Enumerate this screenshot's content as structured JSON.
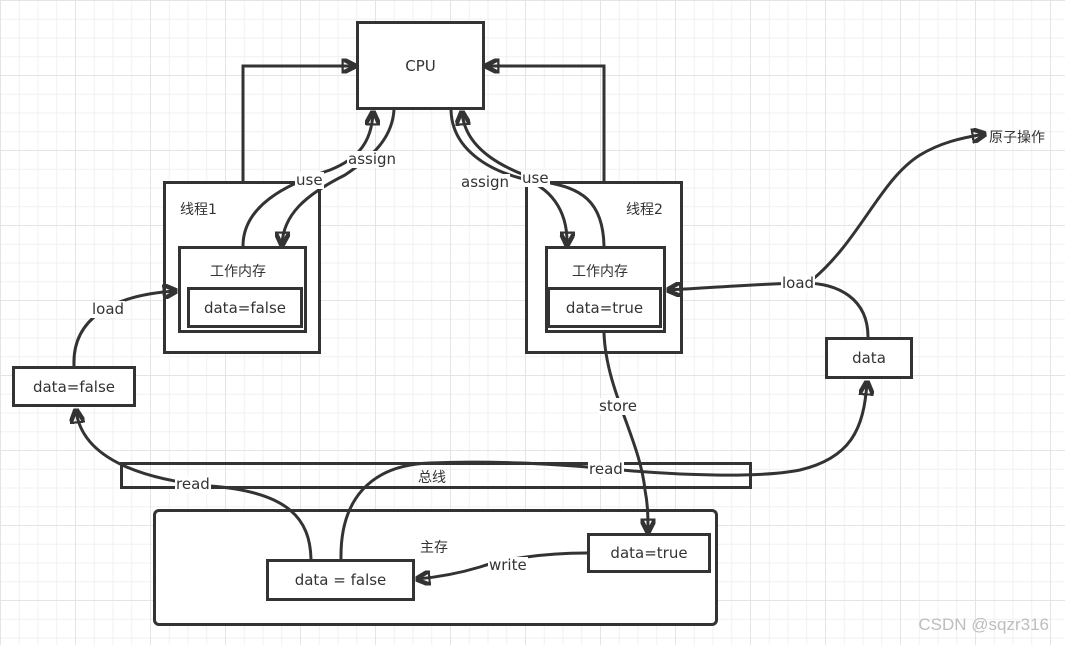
{
  "nodes": {
    "cpu": "CPU",
    "thread1": {
      "title": "线程1",
      "working_memory": "工作内存",
      "value": "data=false"
    },
    "thread2": {
      "title": "线程2",
      "working_memory": "工作内存",
      "value": "data=true"
    },
    "left_data": "data=false",
    "right_data": "data",
    "bus": "总线",
    "main_memory": {
      "title": "主存",
      "value_false": "data = false",
      "value_true": "data=true"
    },
    "atomic_ops": "原子操作"
  },
  "edges": {
    "t1_use": "use",
    "t1_assign": "assign",
    "t2_assign": "assign",
    "t2_use": "use",
    "t1_load": "load",
    "t2_load": "load",
    "store": "store",
    "read_left": "read",
    "read_right": "read",
    "write": "write"
  },
  "watermark": "CSDN @sqzr316",
  "colors": {
    "stroke": "#333333",
    "text": "#333333",
    "grid_major": "#e4e4e4",
    "grid_minor": "#f1f1f1",
    "watermark": "#bdbdbd"
  }
}
